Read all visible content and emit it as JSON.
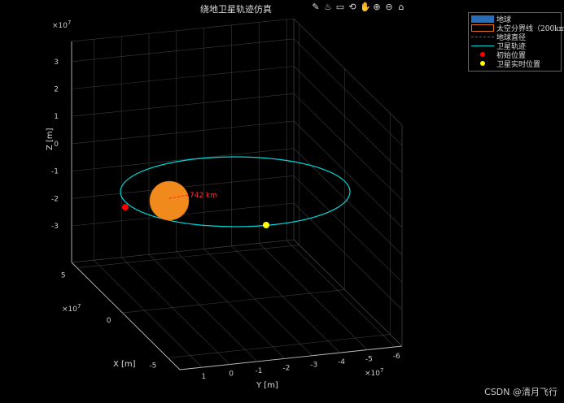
{
  "title": "绕地卫星轨迹仿真",
  "toolbar": [
    "edit-icon",
    "brush-icon",
    "datatip-icon",
    "rotate-icon",
    "pan-icon",
    "zoom-in-icon",
    "zoom-out-icon",
    "home-icon"
  ],
  "toolbar_glyphs": [
    "✎",
    "♨",
    "▭",
    "⟲",
    "✋",
    "⊕",
    "⊖",
    "⌂"
  ],
  "legend": [
    {
      "label": "地球",
      "color": "#2b6cb8"
    },
    {
      "label": "太空分界线（200km）",
      "color": "#e07020"
    },
    {
      "label": "地球直径",
      "color": "#ff2020"
    },
    {
      "label": "卫星轨迹",
      "color": "#00d8d8"
    },
    {
      "label": "初始位置",
      "color": "#ff0000"
    },
    {
      "label": "卫星实时位置",
      "color": "#ffff00"
    }
  ],
  "chart_data": {
    "type": "line",
    "title": "绕地卫星轨迹仿真",
    "xlabel": "X [m]",
    "ylabel": "Y [m]",
    "zlabel": "Z [m]",
    "x_ticks": [
      "5",
      "0",
      "-5"
    ],
    "y_ticks": [
      "1",
      "0",
      "-1",
      "-2",
      "-3",
      "-4",
      "-5",
      "-6"
    ],
    "z_ticks": [
      "3",
      "2",
      "1",
      "0",
      "-1",
      "-2",
      "-3"
    ],
    "axis_exponent": "×10",
    "axis_exponent_power": "7",
    "annotation": "742 km",
    "grid": true,
    "legend_position": "top-right"
  },
  "watermark": "CSDN @清月飞行"
}
